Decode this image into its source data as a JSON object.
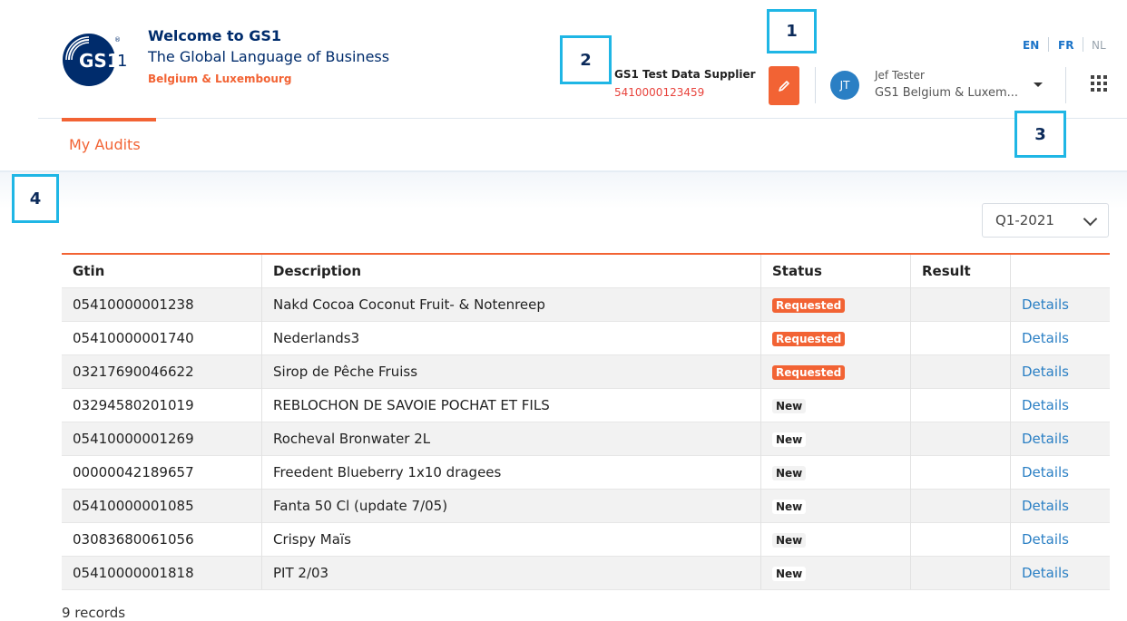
{
  "brand": {
    "title": "Welcome to GS1",
    "subtitle": "The Global Language of Business",
    "region": "Belgium & Luxembourg",
    "logo_text": "GS1",
    "logo_suffix": "1"
  },
  "supplier": {
    "name": "GS1 Test Data Supplier",
    "gln": "5410000123459"
  },
  "user": {
    "initials": "JT",
    "name": "Jef Tester",
    "org": "GS1 Belgium & Luxem..."
  },
  "languages": [
    "EN",
    "FR",
    "NL"
  ],
  "nav": {
    "tab": "My Audits"
  },
  "annotations": [
    "1",
    "2",
    "3",
    "4"
  ],
  "period": {
    "selected": "Q1-2021"
  },
  "table": {
    "columns": [
      "Gtin",
      "Description",
      "Status",
      "Result",
      ""
    ],
    "rows": [
      {
        "gtin": "05410000001238",
        "description": "Nakd Cocoa Coconut Fruit- & Notenreep",
        "status": "Requested",
        "result": "",
        "action": "Details"
      },
      {
        "gtin": "05410000001740",
        "description": "Nederlands3",
        "status": "Requested",
        "result": "",
        "action": "Details"
      },
      {
        "gtin": "03217690046622",
        "description": "Sirop de Pêche Fruiss",
        "status": "Requested",
        "result": "",
        "action": "Details"
      },
      {
        "gtin": "03294580201019",
        "description": "REBLOCHON DE SAVOIE POCHAT ET FILS",
        "status": "New",
        "result": "",
        "action": "Details"
      },
      {
        "gtin": "05410000001269",
        "description": "Rocheval Bronwater 2L",
        "status": "New",
        "result": "",
        "action": "Details"
      },
      {
        "gtin": "00000042189657",
        "description": "Freedent Blueberry 1x10 dragees",
        "status": "New",
        "result": "",
        "action": "Details"
      },
      {
        "gtin": "05410000001085",
        "description": "Fanta 50 Cl (update 7/05)",
        "status": "New",
        "result": "",
        "action": "Details"
      },
      {
        "gtin": "03083680061056",
        "description": "Crispy Maïs",
        "status": "New",
        "result": "",
        "action": "Details"
      },
      {
        "gtin": "05410000001818",
        "description": "PIT 2/03",
        "status": "New",
        "result": "",
        "action": "Details"
      }
    ]
  },
  "footer": {
    "records": "9 records"
  },
  "colors": {
    "brand_orange": "#f26334",
    "brand_navy": "#002c6c",
    "link_blue": "#2a7fc4",
    "callout_border": "#1fb6e5"
  }
}
